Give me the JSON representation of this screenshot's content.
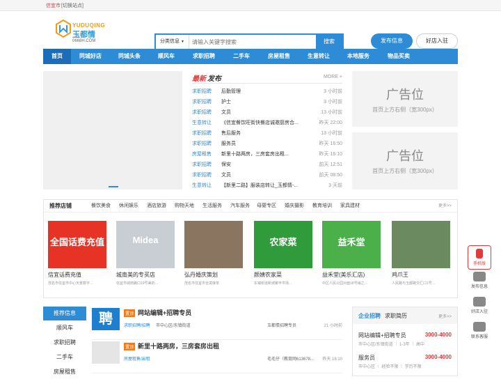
{
  "topbar": {
    "city": "信宜市",
    "switch": "[切换站点]"
  },
  "logo": {
    "en": "YUDUQING",
    "cn": "玉都情",
    "domain": "0668H.COM"
  },
  "search": {
    "category": "分类信息",
    "placeholder": "请输入关键字搜索",
    "button": "搜索"
  },
  "header": {
    "publish": "发布信息",
    "join": "好店入驻"
  },
  "nav": [
    "首页",
    "同城好店",
    "同城头条",
    "顺风车",
    "求职招聘",
    "二手车",
    "房屋租售",
    "生意转让",
    "本地服务",
    "物品买卖"
  ],
  "latest": {
    "title_new": "最新",
    "title_pub": "发布",
    "more": "MORE +",
    "rows": [
      {
        "cat": "求职招聘",
        "title": "后勤管理",
        "time": "3 小时前"
      },
      {
        "cat": "求职招聘",
        "title": "护士",
        "time": "3 小时前"
      },
      {
        "cat": "求职招聘",
        "title": "文员",
        "time": "13 小时前"
      },
      {
        "cat": "生意转让",
        "title": "《信宜餐饮旺街快餐店诚邀厨房合...",
        "time": "昨天 22:00"
      },
      {
        "cat": "求职招聘",
        "title": "售后服务",
        "time": "13 小时前"
      },
      {
        "cat": "求职招聘",
        "title": "服务员",
        "time": "昨天 16:50"
      },
      {
        "cat": "房屋租售",
        "title": "新里十路两房，三房套房出租...",
        "time": "昨天 16:10"
      },
      {
        "cat": "求职招聘",
        "title": "保安",
        "time": "前天 12:51"
      },
      {
        "cat": "求职招聘",
        "title": "文员",
        "time": "前天 08:50"
      },
      {
        "cat": "生意转让",
        "title": "【新里二路】服装店转让_玉都情-...",
        "time": "3 天前"
      }
    ]
  },
  "ads": [
    {
      "big": "广告位",
      "small": "首页上方右侧（宽300px）"
    },
    {
      "big": "广告位",
      "small": "首页上方右侧（宽300px）"
    }
  ],
  "shops": {
    "title": "推荐店铺",
    "tabs": [
      "餐饮美食",
      "休闲娱乐",
      "酒店旅游",
      "购物天地",
      "生活服务",
      "汽车服务",
      "母婴专区",
      "婚庆摄影",
      "教育培训",
      "家具建材"
    ],
    "more": "更多>>",
    "cards": [
      {
        "name": "信宜话费充值",
        "addr": "茂名市信宜市中心天景数字…",
        "banner": "全国话费充值",
        "color": "#e63325"
      },
      {
        "name": "城南美的专买店",
        "addr": "信宜市城南路口19号美的…",
        "banner": "Midea",
        "color": "#c9ced4"
      },
      {
        "name": "弘丹婚庆策划",
        "addr": "茂名市信宜市全境接单",
        "banner": "",
        "color": "#8a7560"
      },
      {
        "name": "颜姨农家菜",
        "addr": "东镇街道新城聚丰市场…",
        "banner": "农家菜",
        "color": "#2f9b3a"
      },
      {
        "name": "益禾堂(美乐汇店)",
        "addr": "中区人民公园对面18号铺之…",
        "banner": "益禾堂",
        "color": "#4bb04a"
      },
      {
        "name": "鸡爪王",
        "addr": "人民路与玉都路交汇口1号…",
        "banner": "",
        "color": "#6b8a60"
      }
    ]
  },
  "leftmenu": {
    "header": "推荐信息",
    "items": [
      "顺风车",
      "求职招聘",
      "二手车",
      "房屋租售"
    ]
  },
  "posts": [
    {
      "tag": "置顶",
      "title": "网站编辑+招聘专员",
      "cat": "求职招聘/招聘",
      "loc": "市中心区/东镇街道",
      "who": "玉都情招聘专员",
      "time": "21 小时前",
      "thumb": "聘"
    },
    {
      "tag": "置顶",
      "title": "新里十路两房，三房套房出租",
      "cat": "房屋租售/出租",
      "loc": "",
      "who": "毛毛仔（教育网613678...",
      "time": "昨天 16:10",
      "thumb": ""
    }
  ],
  "jobs": {
    "tab_a": "企业招聘",
    "tab_b": "求职简历",
    "more": "更多>>",
    "items": [
      {
        "name": "网站编辑+招聘专员",
        "salary": "3000-4000",
        "detail": "市中心区/东镇街道 ｜ 1-3年 ｜ 高中"
      },
      {
        "name": "服务员",
        "salary": "3000-4000",
        "detail": "市中心区 ｜ 经验不限 ｜ 学历不限"
      }
    ]
  },
  "side": [
    "手机版",
    "发布信息",
    "好店入驻",
    "联系客服"
  ],
  "colors": {
    "primary": "#2e8bd6",
    "accent": "#e4393c",
    "top": "#f07a1b"
  }
}
